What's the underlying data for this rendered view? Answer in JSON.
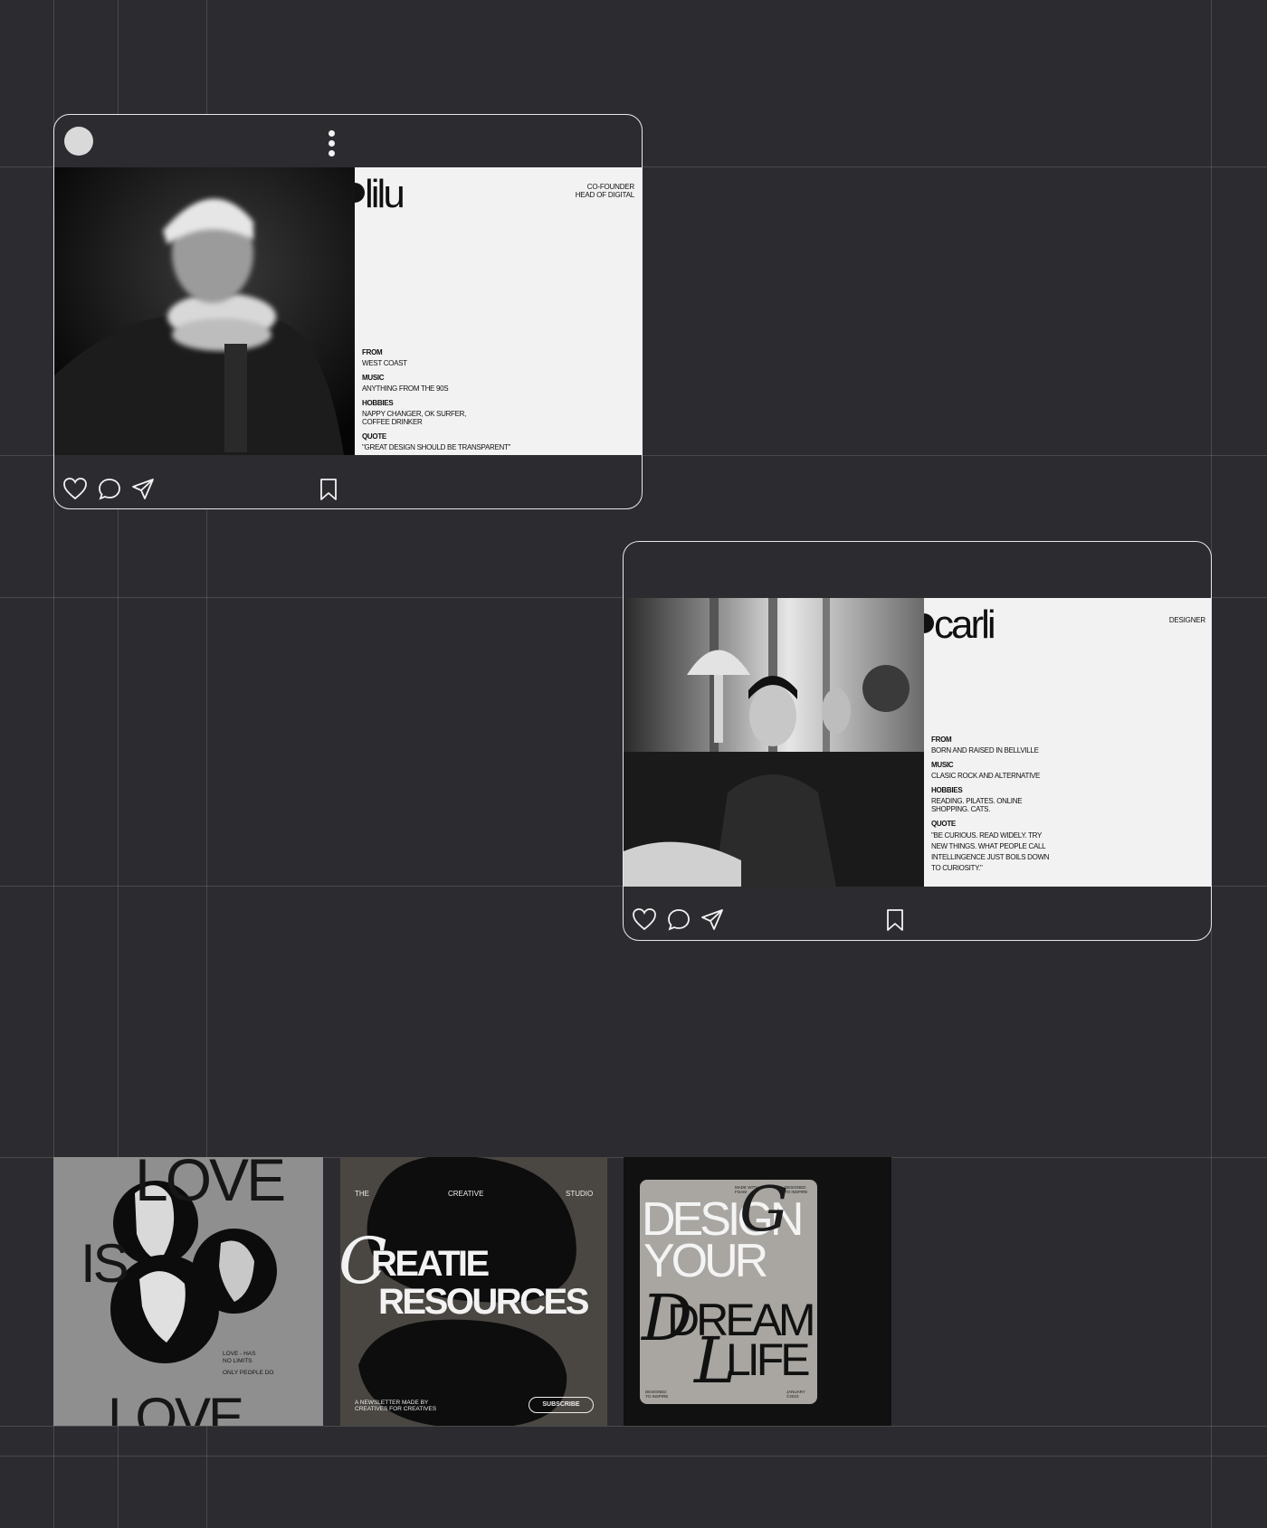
{
  "posts": [
    {
      "name": "lilu",
      "role_lines": [
        "CO-FOUNDER",
        "HEAD OF DIGITAL"
      ],
      "fields": [
        {
          "label": "FROM",
          "value": "WEST COAST"
        },
        {
          "label": "MUSIC",
          "value": "ANYTHING FROM THE 90S"
        },
        {
          "label": "HOBBIES",
          "value": "NAPPY CHANGER, OK SURFER,\nCOFFEE DRINKER"
        },
        {
          "label": "QUOTE",
          "value": "\"GREAT DESIGN SHOULD BE TRANSPARENT\""
        }
      ]
    },
    {
      "name": "carli",
      "role_lines": [
        "DESIGNER"
      ],
      "fields": [
        {
          "label": "FROM",
          "value": "BORN AND RAISED IN BELLVILLE"
        },
        {
          "label": "MUSIC",
          "value": "CLASIC ROCK AND ALTERNATIVE"
        },
        {
          "label": "HOBBIES",
          "value": "READING. PILATES. ONLINE\nSHOPPING. CATS."
        },
        {
          "label": "QUOTE",
          "value": "\"BE CURIOUS. READ WIDELY. TRY\nNEW THINGS. WHAT PEOPLE CALL\nINTELLINGENCE JUST BOILS DOWN\nTO CURIOSITY.\""
        }
      ]
    }
  ],
  "icons": {
    "like": "heart-icon",
    "comment": "comment-icon",
    "share": "send-icon",
    "save": "bookmark-icon",
    "more": "more-vertical-icon"
  },
  "tiles": {
    "love": {
      "top_word": "LOVE",
      "side_word": "IS",
      "bottom_word": "LOVE",
      "caption_line1": "LOVE - HAS",
      "caption_line2": "NO LIMITS",
      "caption_line3": "ONLY PEOPLE DO"
    },
    "creatie": {
      "top_left": "THE",
      "top_center": "CREATIVE",
      "top_right": "STUDIO",
      "script_letter": "C",
      "headline1": "REATIE",
      "headline2": "RESOURCES",
      "footer_line1": "A NEWSLETTER MADE BY",
      "footer_line2": "CREATIVES FOR CREATIVES",
      "button": "SUBSCRIBE"
    },
    "dream": {
      "small_tl1": "MADE WITH",
      "small_tl2": "FOAM",
      "small_tr1": "DESIGNED",
      "small_tr2": "TO INSPIRE",
      "line1": "DESIGN",
      "line2": "YOUR",
      "line3": "DREAM",
      "line4": "LIFE",
      "script_g": "G",
      "script_d": "D",
      "script_l": "L",
      "small_bl1": "DESIGNED",
      "small_bl2": "TO INSPIRE",
      "small_br1": "JANUARY",
      "small_br2": "©2023"
    }
  },
  "colors": {
    "background": "#2c2c30",
    "panel": "#f2f2f2",
    "frame": "#e8e8e8"
  }
}
